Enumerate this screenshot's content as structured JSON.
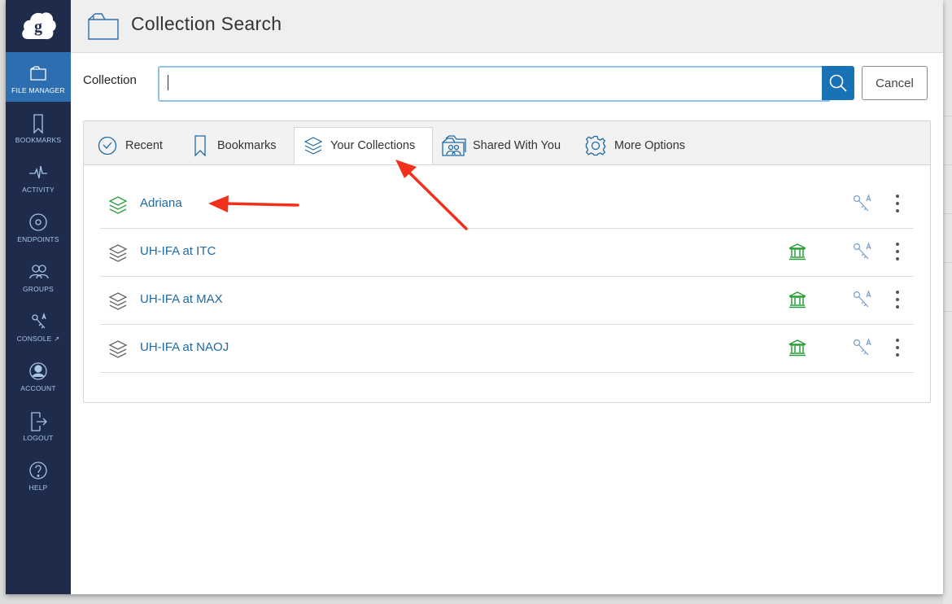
{
  "header": {
    "title": "Collection Search"
  },
  "sidebar": {
    "items": [
      {
        "label": "FILE MANAGER",
        "icon": "file-manager-icon",
        "active": true
      },
      {
        "label": "BOOKMARKS",
        "icon": "bookmark-icon"
      },
      {
        "label": "ACTIVITY",
        "icon": "activity-icon"
      },
      {
        "label": "ENDPOINTS",
        "icon": "endpoints-icon"
      },
      {
        "label": "GROUPS",
        "icon": "groups-icon"
      },
      {
        "label": "CONSOLE",
        "icon": "console-icon"
      },
      {
        "label": "ACCOUNT",
        "icon": "account-icon"
      },
      {
        "label": "LOGOUT",
        "icon": "logout-icon"
      },
      {
        "label": "HELP",
        "icon": "help-icon"
      }
    ]
  },
  "search": {
    "label": "Collection",
    "value": "",
    "cancel_label": "Cancel"
  },
  "tabs": [
    {
      "label": "Recent",
      "icon": "clock-icon"
    },
    {
      "label": "Bookmarks",
      "icon": "bookmark-icon"
    },
    {
      "label": "Your Collections",
      "icon": "layers-icon",
      "active": true
    },
    {
      "label": "Shared With You",
      "icon": "shared-icon"
    },
    {
      "label": "More Options",
      "icon": "gear-icon"
    }
  ],
  "collections": [
    {
      "name": "Adriana",
      "icon_color": "#2a9d3a",
      "institution": false
    },
    {
      "name": "UH-IFA at ITC",
      "icon_color": "#666666",
      "institution": true
    },
    {
      "name": "UH-IFA at MAX",
      "icon_color": "#666666",
      "institution": true
    },
    {
      "name": "UH-IFA at NAOJ",
      "icon_color": "#666666",
      "institution": true
    }
  ],
  "colors": {
    "sidebar": "#1e2b4a",
    "active_nav": "#2c6eb0",
    "link": "#1e6aa3",
    "search_button": "#1872b5",
    "annotation_arrow": "#f2311d",
    "institution": "#2a9d3a"
  }
}
